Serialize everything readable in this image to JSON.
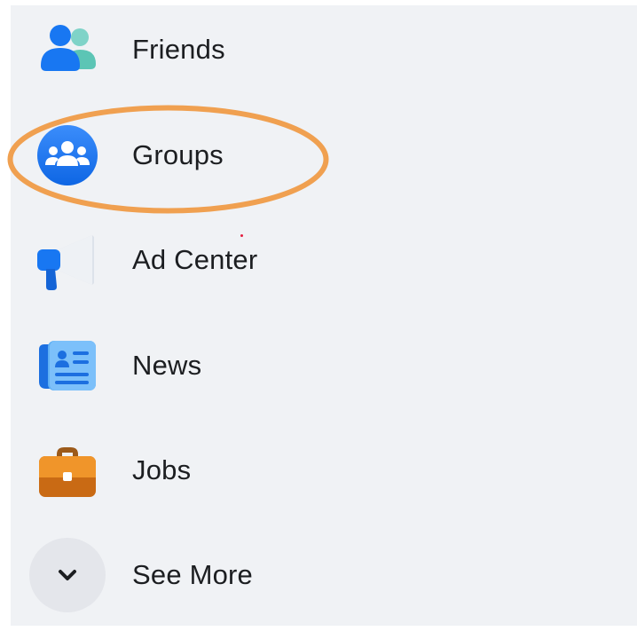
{
  "menu": {
    "items": [
      {
        "label": "Friends",
        "icon": "friends-icon"
      },
      {
        "label": "Groups",
        "icon": "groups-icon",
        "highlighted": true
      },
      {
        "label": "Ad Center",
        "icon": "megaphone-icon"
      },
      {
        "label": "News",
        "icon": "newspaper-icon"
      },
      {
        "label": "Jobs",
        "icon": "briefcase-icon"
      }
    ],
    "see_more": {
      "label": "See More",
      "icon": "chevron-down-icon"
    }
  },
  "colors": {
    "panel_background": "#f0f2f5",
    "text": "#1c1e21",
    "highlight_ring": "#f0a050",
    "brand_blue": "#1877f2"
  }
}
